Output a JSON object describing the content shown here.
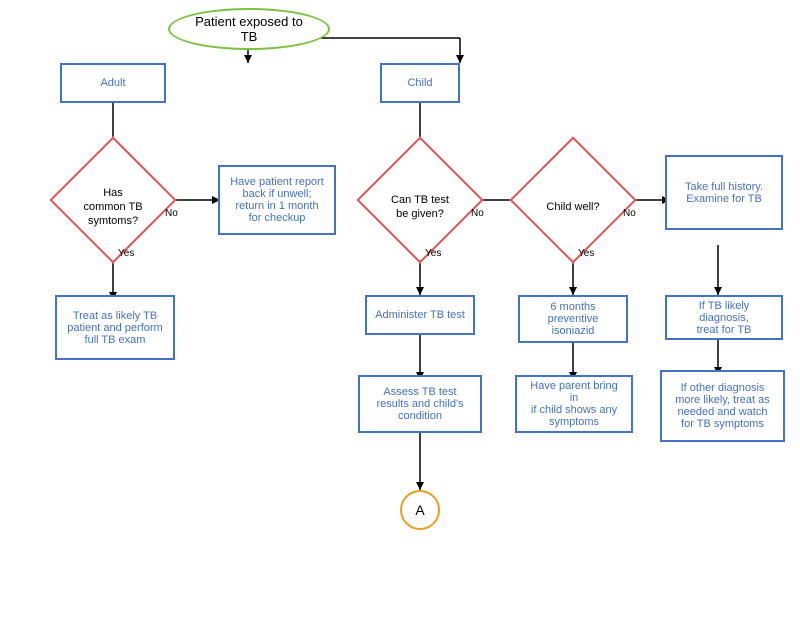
{
  "nodes": {
    "start": {
      "label": "Patient exposed to TB"
    },
    "adult": {
      "label": "Adult"
    },
    "child": {
      "label": "Child"
    },
    "has_tb_symptoms": {
      "label": "Has\ncommon TB\nsymtoms?"
    },
    "report_back": {
      "label": "Have patient report\nback if unwell;\nreturn in 1 month\nfor checkup"
    },
    "treat_likely": {
      "label": "Treat as likely TB\npatient and perform\nfull TB exam"
    },
    "can_tb_test": {
      "label": "Can TB test\nbe given?"
    },
    "child_well": {
      "label": "Child well?"
    },
    "take_history": {
      "label": "Take full history.\nExamine for TB"
    },
    "administer_tb": {
      "label": "Administer TB test"
    },
    "preventive_iso": {
      "label": "6 months\npreventive isoniazid"
    },
    "if_tb_likely": {
      "label": "If TB likely diagnosis,\ntreat for TB"
    },
    "assess_tb": {
      "label": "Assess TB test\nresults and child's\ncondition"
    },
    "bring_parent": {
      "label": "Have parent bring in\nif child shows any\nsymptoms"
    },
    "other_diagnosis": {
      "label": "If other diagnosis\nmore likely, treat as\nneeded and watch\nfor TB symptoms"
    },
    "connector_a": {
      "label": "A"
    }
  },
  "labels": {
    "no": "No",
    "yes": "Yes"
  }
}
